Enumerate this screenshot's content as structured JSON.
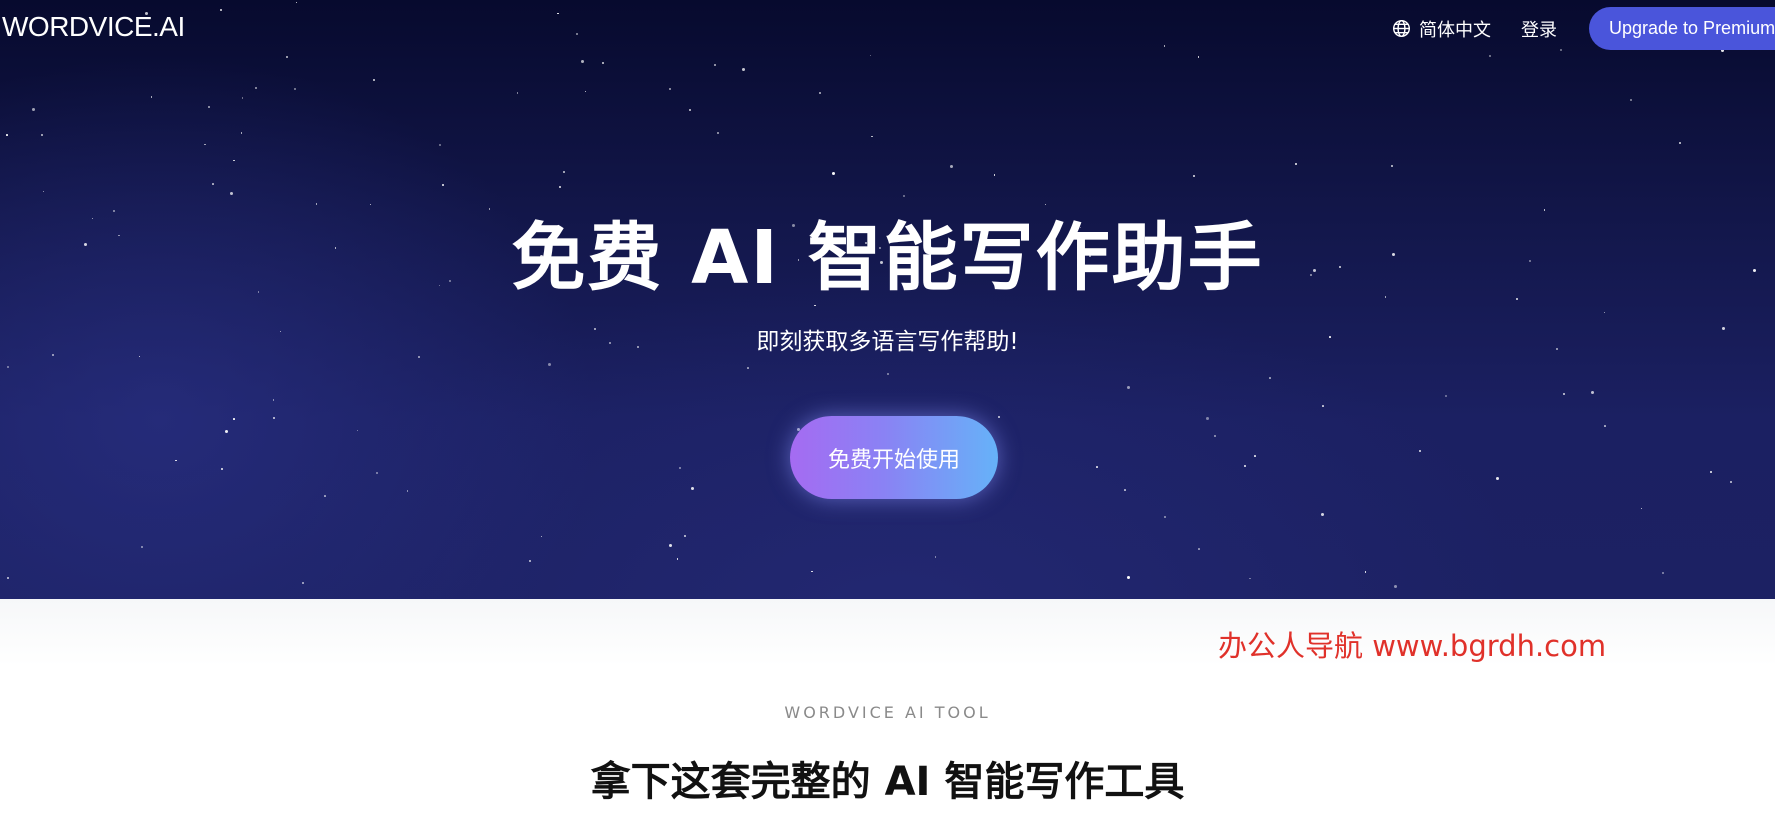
{
  "header": {
    "logo": "WORDVICE.AI",
    "language_label": "简体中文",
    "language_icon": "globe-icon",
    "login_label": "登录",
    "upgrade_label": "Upgrade to Premium"
  },
  "hero": {
    "title": "免费 AI 智能写作助手",
    "subtitle": "即刻获取多语言写作帮助!",
    "cta_label": "免费开始使用"
  },
  "watermark": "办公人导航 www.bgrdh.com",
  "tools_section": {
    "eyebrow": "WORDVICE AI TOOL",
    "title": "拿下这套完整的 AI 智能写作工具"
  },
  "colors": {
    "hero_background": "#141850",
    "upgrade_button": "#4a55db",
    "cta_gradient_start": "#a56bf2",
    "cta_gradient_end": "#66b2f8",
    "watermark": "#e0312a"
  }
}
